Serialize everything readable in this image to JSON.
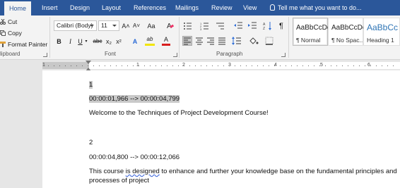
{
  "tabs": [
    {
      "label": "Home",
      "active": true
    },
    {
      "label": "Insert"
    },
    {
      "label": "Design"
    },
    {
      "label": "Layout"
    },
    {
      "label": "References"
    },
    {
      "label": "Mailings"
    },
    {
      "label": "Review"
    },
    {
      "label": "View"
    }
  ],
  "tell_me": "Tell me what you want to do...",
  "clipboard": {
    "cut": "Cut",
    "copy": "Copy",
    "format_painter": "Format Painter",
    "group_label": "lipboard"
  },
  "font": {
    "name": "Calibri (Body)",
    "size": "11",
    "grow": "A˄",
    "shrink": "A˅",
    "change_case": "Aa",
    "bold": "B",
    "italic": "I",
    "underline": "U",
    "strike": "abc",
    "subscript": "x₂",
    "superscript": "x²",
    "text_effects": "A",
    "highlight": "ab",
    "font_color": "A",
    "group_label": "Font"
  },
  "paragraph": {
    "group_label": "Paragraph",
    "show_marks": "¶"
  },
  "styles": [
    {
      "sample": "AaBbCcDc",
      "name": "¶ Normal",
      "selected": true
    },
    {
      "sample": "AaBbCcDc",
      "name": "¶ No Spac..."
    },
    {
      "sample": "AaBbCc",
      "name": "Heading 1"
    }
  ],
  "ruler": {
    "numbers": [
      "1",
      "1",
      "2",
      "3",
      "4",
      "5",
      "6"
    ]
  },
  "document": {
    "lines": [
      {
        "text": "1",
        "highlight": true
      },
      {
        "text": "00:00:01,966 --> 00:00:04,799",
        "highlight": true
      },
      {
        "text": "Welcome to the Techniques of Project Development Course!"
      },
      {
        "text": "2"
      },
      {
        "text": "00:00:04,800 --> 00:00:12,066"
      },
      {
        "pre": "This course ",
        "squiggle": "is designed",
        "post": " to enhance and further your knowledge base on the fundamental principles and"
      },
      {
        "text": "processes of project"
      }
    ]
  },
  "colors": {
    "tab_bar": "#2b579a",
    "ribbon": "#f3f3f3",
    "highlight_yellow": "#f2e500",
    "font_red": "#d81e1e",
    "selection": "#c9c9c9"
  }
}
